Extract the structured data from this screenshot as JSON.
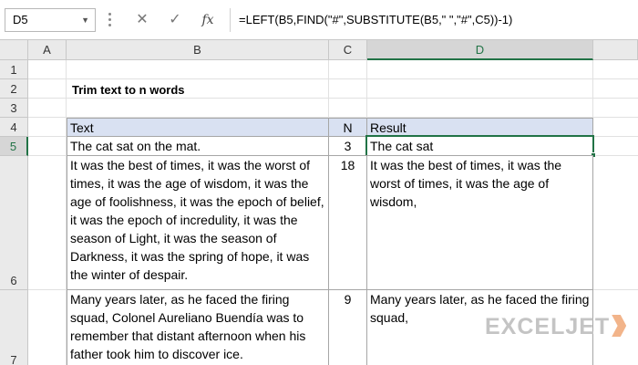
{
  "formula_bar": {
    "name_box": "D5",
    "cancel_symbol": "✕",
    "enter_symbol": "✓",
    "fx_symbol": "fx",
    "formula": "=LEFT(B5,FIND(\"#\",SUBSTITUTE(B5,\" \",\"#\",C5))-1)"
  },
  "grid": {
    "columns": [
      "A",
      "B",
      "C",
      "D"
    ],
    "rows": [
      "1",
      "2",
      "3",
      "4",
      "5",
      "6",
      "7"
    ],
    "active_column": "D",
    "active_row": "5"
  },
  "sheet": {
    "title": "Trim text to n words",
    "headers": {
      "text": "Text",
      "n": "N",
      "result": "Result"
    },
    "rows": [
      {
        "text": "The cat sat on the mat.",
        "n": "3",
        "result": "The cat sat"
      },
      {
        "text": "It was the best of times, it was the worst of times, it was the age of wisdom, it was the age of foolishness, it was the epoch of belief, it was the epoch of incredulity, it was the season of Light, it was the season of Darkness, it was the spring of hope, it was the winter of despair.",
        "n": "18",
        "result": "It was the best of times, it was the worst of times, it was the age of wisdom,"
      },
      {
        "text": "Many years later, as he faced the firing squad, Colonel Aureliano Buendía was to remember that distant afternoon when his father took him to discover ice.",
        "n": "9",
        "result": "Many years later, as he faced the firing squad,"
      }
    ]
  },
  "watermark": {
    "text": "EXCELJET"
  },
  "colors": {
    "accent": "#217346",
    "header_fill": "#d9e1f2"
  }
}
